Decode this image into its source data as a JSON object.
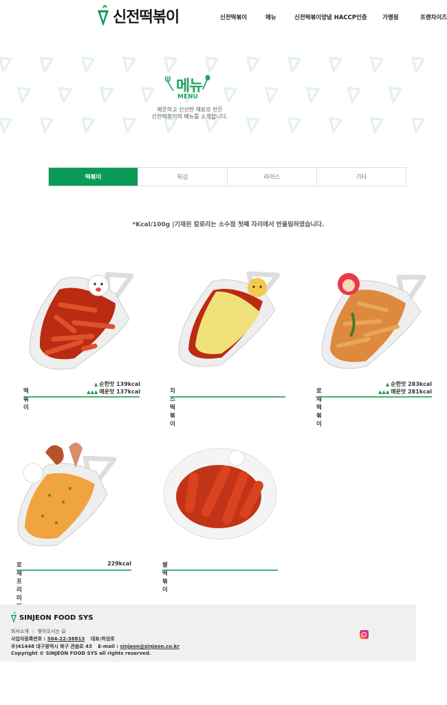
{
  "brand": {
    "name": "신전떡볶이",
    "green": "#0b9b58"
  },
  "nav": [
    "신전떡볶이",
    "메뉴",
    "신전떡볶이양념 HACCP인증",
    "가맹점",
    "프랜차이즈"
  ],
  "hero": {
    "title": "메뉴",
    "subtitle": "MENU",
    "desc_line1": "깨끗하고 신선한 재료로 만든",
    "desc_line2": "신전떡볶이의 메뉴를 소개합니다."
  },
  "tabs": [
    {
      "label": "떡볶이",
      "active": true
    },
    {
      "label": "튀김",
      "active": false
    },
    {
      "label": "라이스",
      "active": false
    },
    {
      "label": "기타",
      "active": false
    }
  ],
  "note": "*Kcal/100g |기재된 칼로리는 소수점 첫째 자리에서 반올림하였습니다.",
  "menu": [
    {
      "name": "떡볶이",
      "kcal_mild": "순한맛 139kcal",
      "kcal_spicy": "매운맛 137kcal"
    },
    {
      "name": "치즈떡볶이"
    },
    {
      "name": "로제떡볶이",
      "kcal_mild": "순한맛 283kcal",
      "kcal_spicy": "매운맛 281kcal"
    },
    {
      "name": "로제 프리미엄 떡볶이",
      "kcal": "229kcal"
    },
    {
      "name": "쌀떡볶이"
    }
  ],
  "footer": {
    "logo": "SINJEON FOOD SYS",
    "link_about": "회사소개",
    "link_directions": "찾아오시는 길",
    "biz_label": "사업자등록번호 : ",
    "biz_no": "504-22-36813",
    "ceo": "대표:허성호",
    "address": "우)41448 대구광역시 북구 관음로 43",
    "email_label": "E-mail : ",
    "email": "sinjeon@sinjeon.co.kr",
    "copyright": "Copyright © SINJEON FOOD SYS all rights reserved."
  },
  "icons": {
    "instagram": "instagram-icon",
    "logo": "carrot-logo-icon",
    "menu_title": "fork-spoon-icon"
  }
}
